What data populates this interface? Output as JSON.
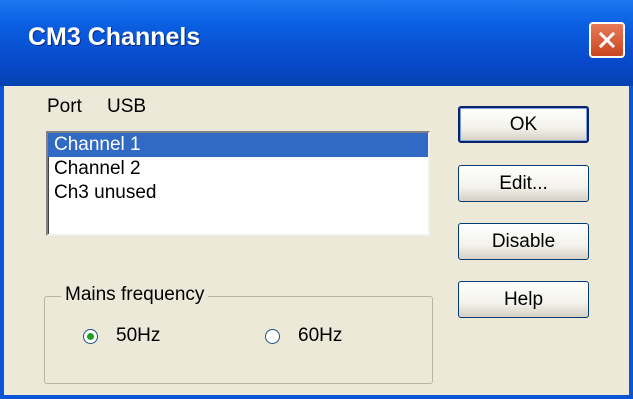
{
  "window": {
    "title": "CM3 Channels"
  },
  "port": {
    "label": "Port",
    "value": "USB"
  },
  "channels": {
    "items": [
      {
        "label": "Channel 1",
        "selected": true
      },
      {
        "label": "Channel 2",
        "selected": false
      },
      {
        "label": "Ch3 unused",
        "selected": false
      }
    ]
  },
  "mains": {
    "label": "Mains frequency",
    "options": [
      {
        "label": "50Hz",
        "checked": true
      },
      {
        "label": "60Hz",
        "checked": false
      }
    ]
  },
  "buttons": {
    "ok": "OK",
    "edit": "Edit...",
    "disable": "Disable",
    "help": "Help"
  },
  "colors": {
    "titlebar": "#0a5ee0",
    "selection": "#316ac5",
    "close": "#d9532c"
  }
}
